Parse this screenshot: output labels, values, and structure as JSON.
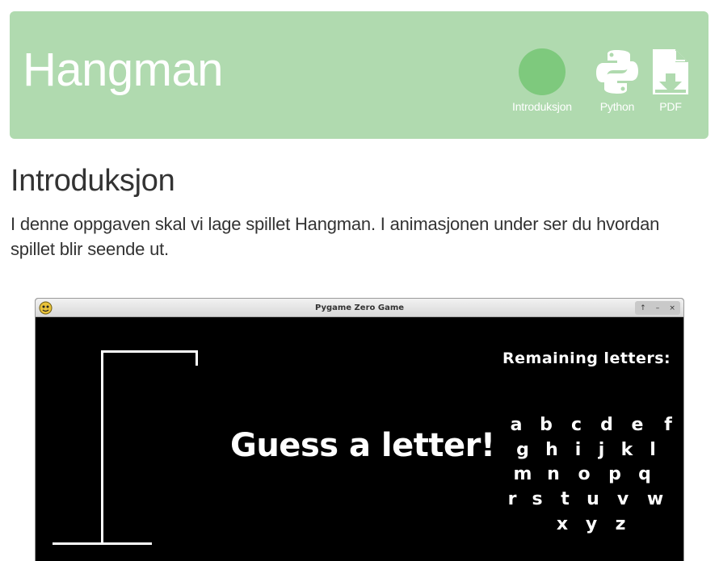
{
  "header": {
    "title": "Hangman",
    "background": "#b0daaf",
    "nav": [
      {
        "label": "Introduksjon",
        "icon": "circle-icon"
      },
      {
        "label": "Python",
        "icon": "python-icon"
      },
      {
        "label": "PDF",
        "icon": "pdf-download-icon"
      }
    ]
  },
  "intro": {
    "heading": "Introduksjon",
    "text": "I denne oppgaven skal vi lage spillet Hangman. I animasjonen under ser du hvordan spillet blir seende ut."
  },
  "game_window": {
    "title": "Pygame Zero Game",
    "controls": [
      "↑",
      "–",
      "×"
    ],
    "message": "Guess a letter!",
    "remaining_label": "Remaining letters:",
    "letters": [
      [
        "a",
        "b",
        "c",
        "d",
        "e",
        "f"
      ],
      [
        "g",
        "h",
        "i",
        "j",
        "k",
        "l"
      ],
      [
        "m",
        "n",
        "o",
        "p",
        "q"
      ],
      [
        "r",
        "s",
        "t",
        "u",
        "v",
        "w"
      ],
      [
        "x",
        "y",
        "z"
      ]
    ]
  }
}
